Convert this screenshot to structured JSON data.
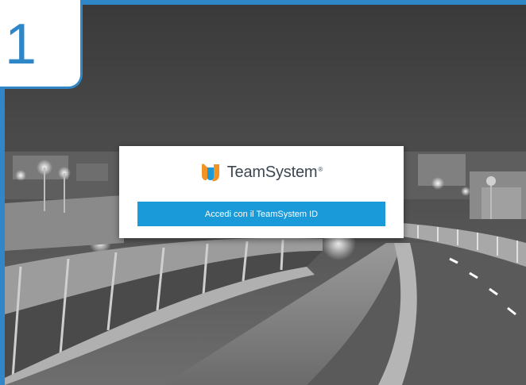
{
  "step": {
    "number": "1"
  },
  "login": {
    "brand_name": "TeamSystem",
    "brand_reg": "®",
    "button_label": "Accedi con il TeamSystem ID"
  },
  "colors": {
    "frame_blue": "#2f87c7",
    "button_blue": "#1a9ad8",
    "logo_orange": "#f39323",
    "logo_blue": "#1a9ad8",
    "brand_text": "#3b4752"
  },
  "icons": {
    "brand_logo": "teamsystem-logo-icon"
  }
}
